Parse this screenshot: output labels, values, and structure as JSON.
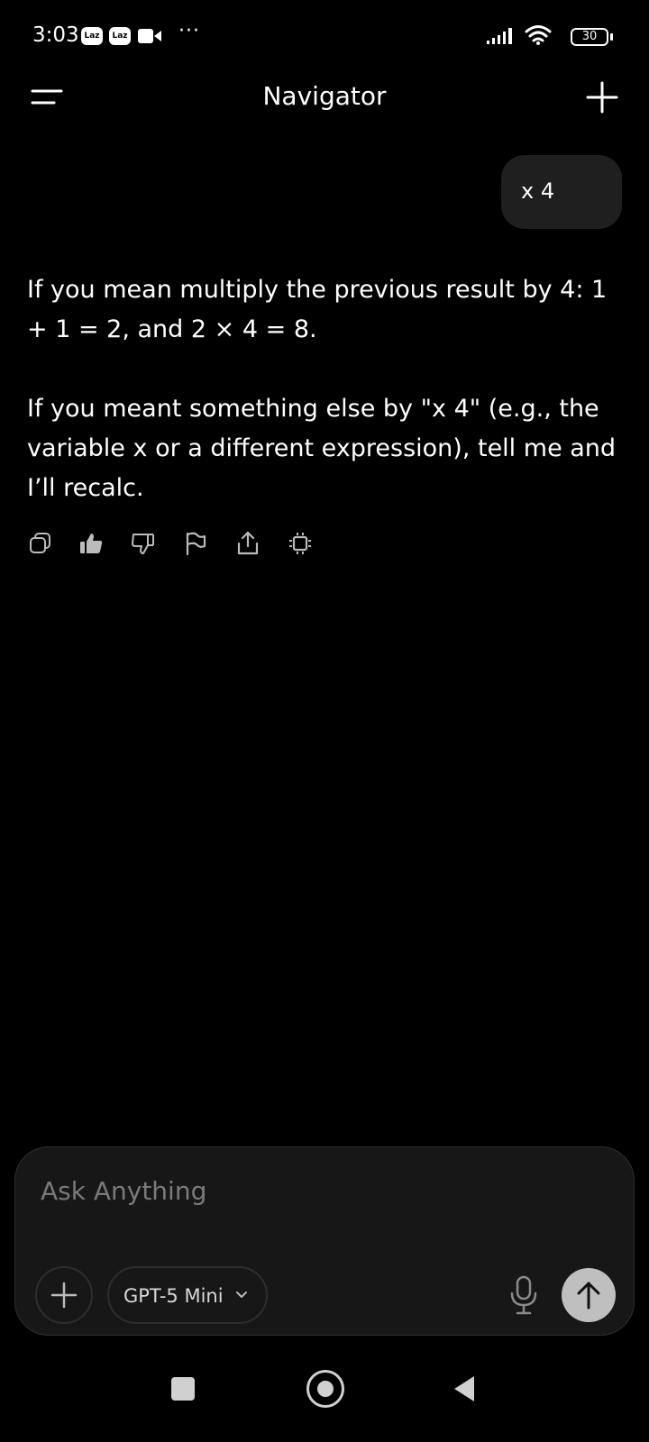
{
  "status_bar": {
    "time": "3:03",
    "badges": [
      "Laz",
      "Laz"
    ],
    "battery": "30"
  },
  "header": {
    "title": "Navigator"
  },
  "conversation": {
    "user_message": "x 4",
    "assistant_paragraphs": [
      "If you mean multiply the previous result by 4: 1 + 1 = 2, and 2 × 4 = 8.",
      "If you meant something else by \"x 4\" (e.g., the variable x or a different expression), tell me and I’ll recalc."
    ],
    "actions": [
      "copy-icon",
      "thumbs-up-icon",
      "thumbs-down-icon",
      "flag-icon",
      "share-icon",
      "chip-icon"
    ]
  },
  "composer": {
    "placeholder": "Ask Anything",
    "value": "",
    "model": "GPT-5 Mini"
  },
  "colors": {
    "background": "#000000",
    "bubble": "#1f1f1f",
    "composer": "#171717",
    "send_button": "#bfbfbf"
  }
}
